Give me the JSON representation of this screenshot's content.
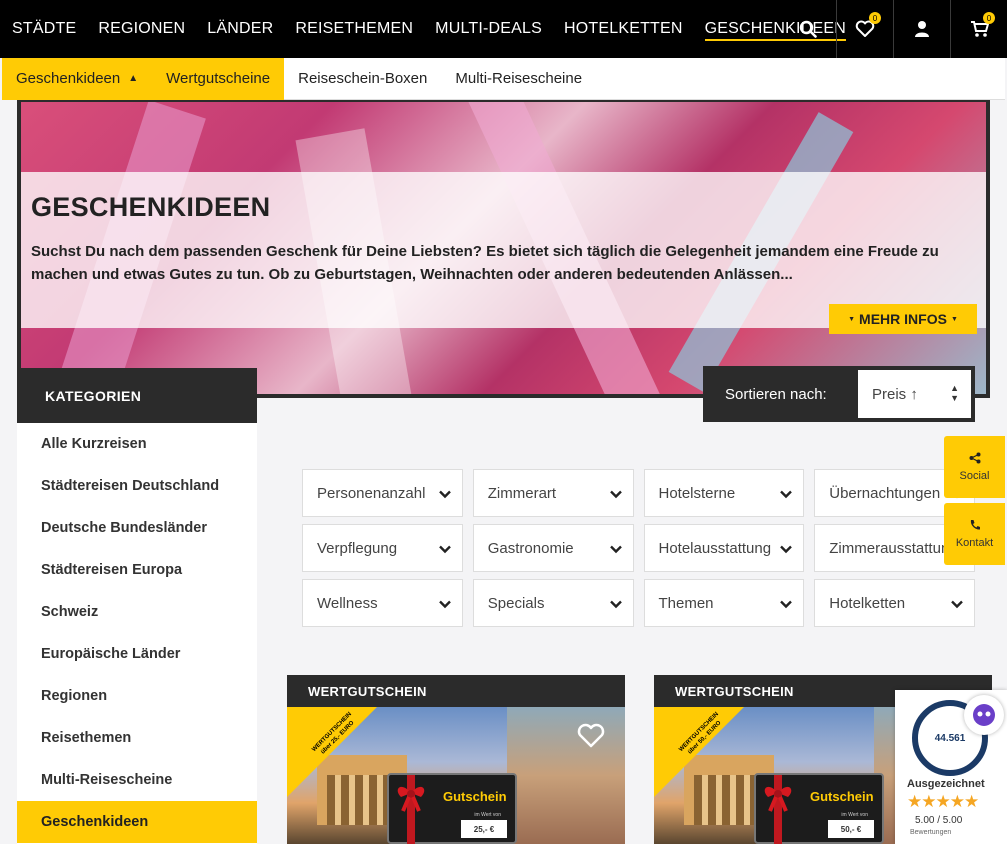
{
  "topnav": {
    "links": [
      "STÄDTE",
      "REGIONEN",
      "LÄNDER",
      "REISETHEMEN",
      "MULTI-DEALS",
      "HOTELKETTEN",
      "GESCHENKIDEEN"
    ],
    "wishlist_count": "0",
    "cart_count": "0"
  },
  "subnav": {
    "items": [
      "Geschenkideen",
      "Wertgutscheine",
      "Reiseschein-Boxen",
      "Multi-Reisescheine"
    ]
  },
  "hero": {
    "title": "GESCHENKIDEEN",
    "text": "Suchst Du nach dem passenden Geschenk für Deine Liebsten? Es bietet sich täglich die Gelegenheit jemandem eine Freude zu machen und etwas Gutes zu tun. Ob zu Geburtstagen, Weihnachten oder anderen bedeutenden Anlässen...",
    "more_label": "MEHR INFOS"
  },
  "sidebar": {
    "title": "KATEGORIEN",
    "items": [
      "Alle Kurzreisen",
      "Städtereisen Deutschland",
      "Deutsche Bundesländer",
      "Städtereisen Europa",
      "Schweiz",
      "Europäische Länder",
      "Regionen",
      "Reisethemen",
      "Multi-Reisescheine",
      "Geschenkideen"
    ]
  },
  "sort": {
    "label": "Sortieren nach:",
    "value": "Preis ↑"
  },
  "filters": [
    [
      "Personenanzahl",
      "Zimmerart",
      "Hotelsterne",
      "Übernachtungen"
    ],
    [
      "Verpflegung",
      "Gastronomie",
      "Hotelausstattung",
      "Zimmerausstattung"
    ],
    [
      "Wellness",
      "Specials",
      "Themen",
      "Hotelketten"
    ]
  ],
  "side_buttons": {
    "social": "Social",
    "contact": "Kontakt"
  },
  "cards": [
    {
      "label": "WERTGUTSCHEIN",
      "corner": "WERTGUTSCHEIN über 25,- EURO",
      "voucher": "Gutschein",
      "value_small": "im Wert von",
      "value": "25,- €"
    },
    {
      "label": "WERTGUTSCHEIN",
      "corner": "WERTGUTSCHEIN über 50,- EURO",
      "voucher": "Gutschein",
      "value_small": "im Wert von",
      "value": "50,- €"
    }
  ],
  "trust": {
    "count": "44.561",
    "award": "Ausgezeichnet",
    "stars": "★★★★★",
    "score": "5.00 / 5.00",
    "sub": "Bewertungen"
  },
  "colors": {
    "accent": "#ffcb05",
    "dark": "#2b2b2b",
    "nav": "#000000"
  }
}
